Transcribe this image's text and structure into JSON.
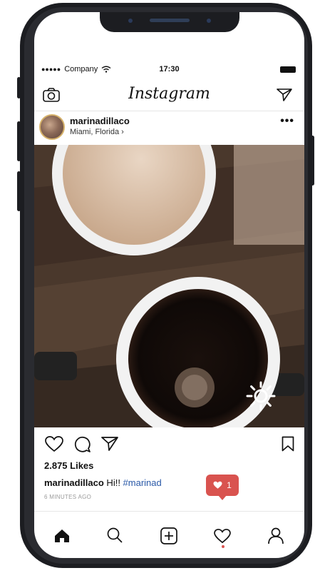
{
  "status_bar": {
    "signal_dots": "●●●●●",
    "carrier": "Company",
    "time": "17:30"
  },
  "header": {
    "logo": "Instagram",
    "icons": [
      "camera-icon",
      "send-icon"
    ]
  },
  "post": {
    "username": "marinadillaco",
    "location": "Miami, Florida ›",
    "more": "•••",
    "likes": "2.875 Likes",
    "caption": {
      "user": "marinadillaco",
      "text": " Hi!! ",
      "hashtag": "#marinad"
    },
    "time_ago": "6 MINUTES AGO"
  },
  "notification": {
    "count": "1",
    "icon": "heart-icon",
    "color": "#d9534f"
  },
  "tab_bar": {
    "items": [
      "home-icon",
      "search-icon",
      "add-icon",
      "heart-icon",
      "profile-icon"
    ]
  }
}
